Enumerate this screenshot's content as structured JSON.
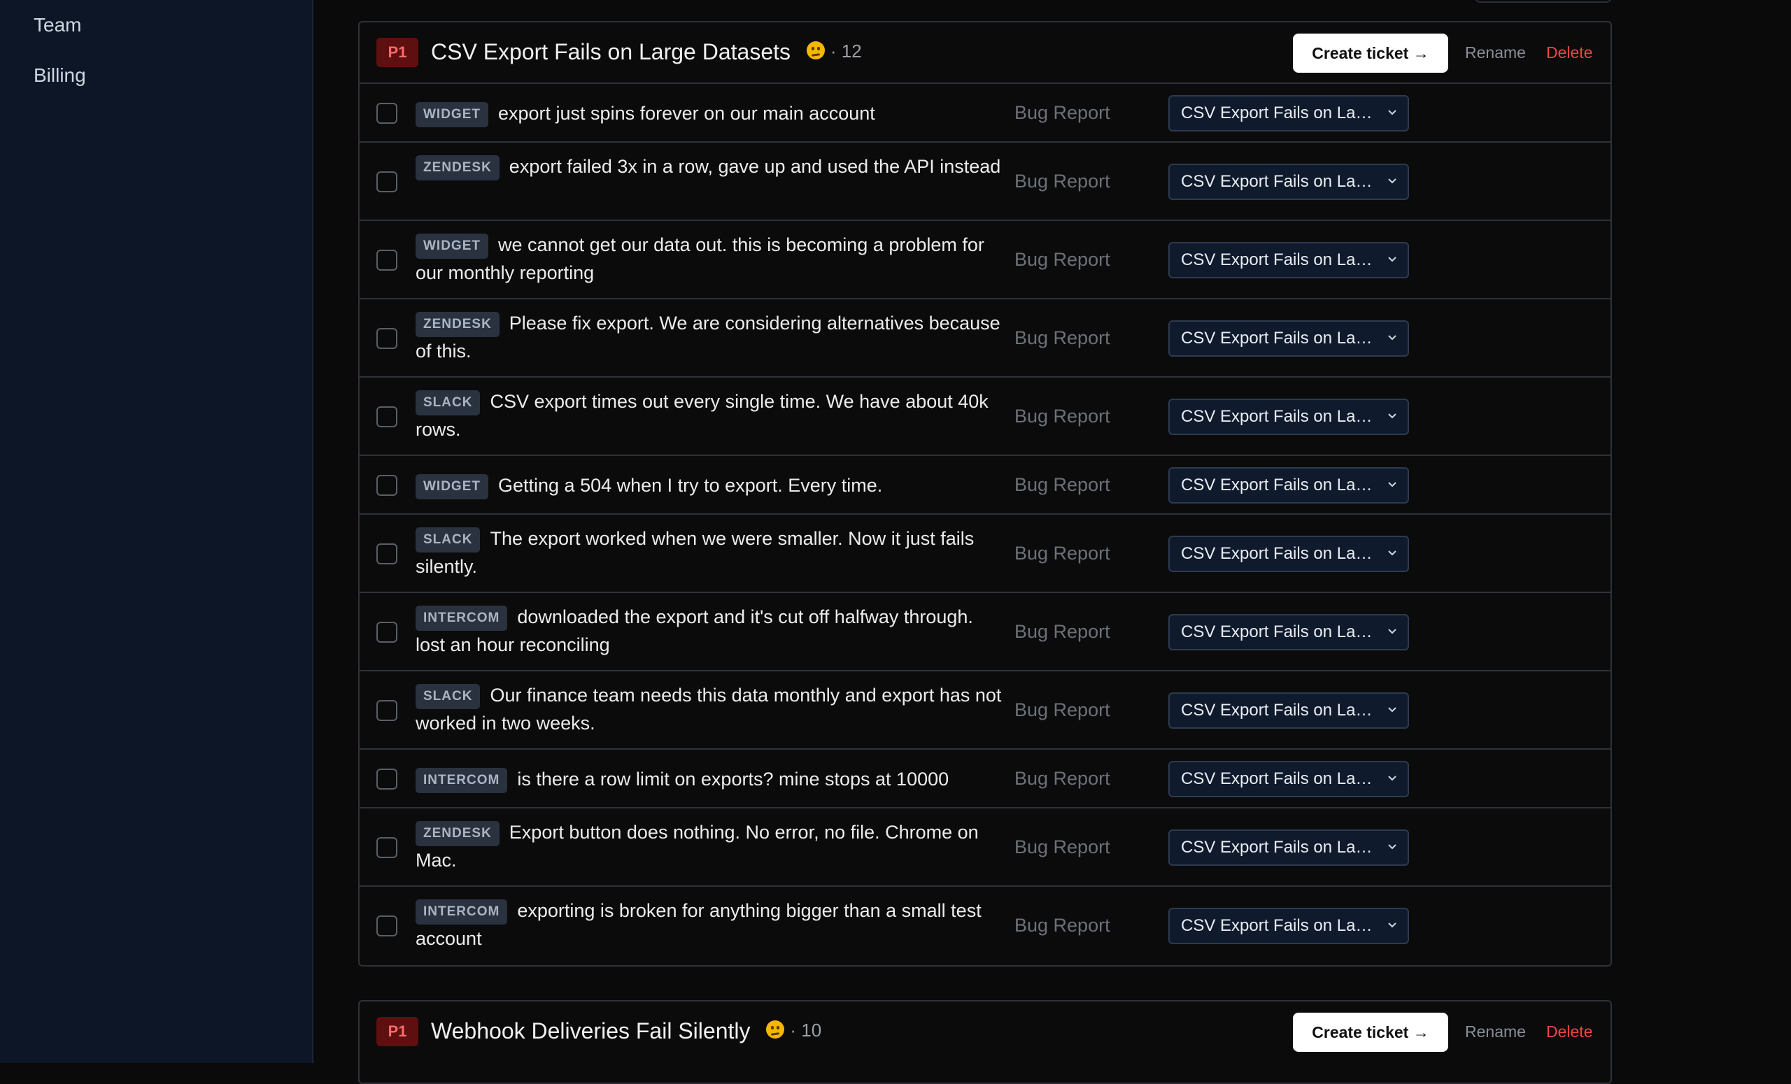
{
  "sidebar": {
    "items": [
      {
        "label": "Team"
      },
      {
        "label": "Billing"
      }
    ]
  },
  "groups": [
    {
      "priority": "P1",
      "title": "CSV Export Fails on Large Datasets",
      "count": "· 12",
      "create_label": "Create ticket →",
      "rename_label": "Rename",
      "delete_label": "Delete",
      "rows": [
        {
          "source": "WIDGET",
          "text": "export just spins forever on our main account",
          "category": "Bug Report",
          "cluster": "CSV Export Fails on La…"
        },
        {
          "source": "ZENDESK",
          "text": "export failed 3x in a row, gave up and used the API instead",
          "category": "Bug Report",
          "cluster": "CSV Export Fails on La…"
        },
        {
          "source": "WIDGET",
          "text": "we cannot get our data out. this is becoming a problem for our monthly reporting",
          "category": "Bug Report",
          "cluster": "CSV Export Fails on La…"
        },
        {
          "source": "ZENDESK",
          "text": "Please fix export. We are considering alternatives because of this.",
          "category": "Bug Report",
          "cluster": "CSV Export Fails on La…"
        },
        {
          "source": "SLACK",
          "text": "CSV export times out every single time. We have about 40k rows.",
          "category": "Bug Report",
          "cluster": "CSV Export Fails on La…"
        },
        {
          "source": "WIDGET",
          "text": "Getting a 504 when I try to export. Every time.",
          "category": "Bug Report",
          "cluster": "CSV Export Fails on La…"
        },
        {
          "source": "SLACK",
          "text": "The export worked when we were smaller. Now it just fails silently.",
          "category": "Bug Report",
          "cluster": "CSV Export Fails on La…"
        },
        {
          "source": "INTERCOM",
          "text": "downloaded the export and it's cut off halfway through. lost an hour reconciling",
          "category": "Bug Report",
          "cluster": "CSV Export Fails on La…"
        },
        {
          "source": "SLACK",
          "text": "Our finance team needs this data monthly and export has not worked in two weeks.",
          "category": "Bug Report",
          "cluster": "CSV Export Fails on La…"
        },
        {
          "source": "INTERCOM",
          "text": "is there a row limit on exports? mine stops at 10000",
          "category": "Bug Report",
          "cluster": "CSV Export Fails on La…"
        },
        {
          "source": "ZENDESK",
          "text": "Export button does nothing. No error, no file. Chrome on Mac.",
          "category": "Bug Report",
          "cluster": "CSV Export Fails on La…"
        },
        {
          "source": "INTERCOM",
          "text": "exporting is broken for anything bigger than a small test account",
          "category": "Bug Report",
          "cluster": "CSV Export Fails on La…"
        }
      ]
    },
    {
      "priority": "P1",
      "title": "Webhook Deliveries Fail Silently",
      "count": "· 10",
      "create_label": "Create ticket →",
      "rename_label": "Rename",
      "delete_label": "Delete",
      "rows": []
    }
  ],
  "colors": {
    "sidebar_bg": "#0c1627",
    "priority_badge_bg": "#5e0f0f",
    "priority_badge_text": "#ff6b6b",
    "delete_link": "#ef4444",
    "create_button_bg": "#ffffff"
  }
}
